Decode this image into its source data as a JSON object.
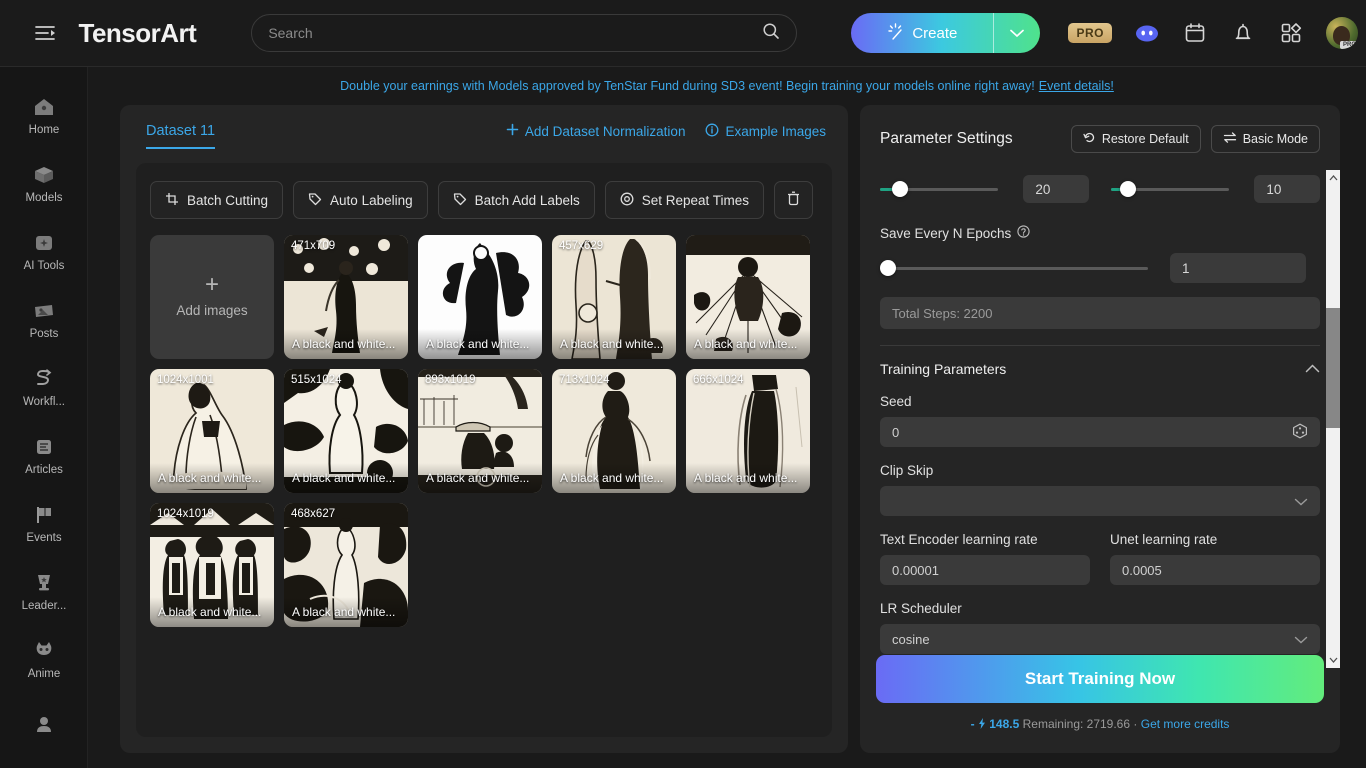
{
  "topbar": {
    "menu_icon": "menu-collapse-icon",
    "brand": "TensorArt",
    "search": {
      "value": "",
      "placeholder": "Search",
      "icon": "search-icon"
    },
    "create_label": "Create",
    "create_icon": "magic-wand-icon",
    "create_caret_icon": "chevron-down-icon",
    "pro_badge": "PRO",
    "icons": [
      "discord-icon",
      "calendar-icon",
      "bell-icon",
      "apps-grid-icon"
    ],
    "avatar_badge": "PRO"
  },
  "sidebar": {
    "items": [
      {
        "label": "Home",
        "icon": "home-icon"
      },
      {
        "label": "Models",
        "icon": "cube-icon"
      },
      {
        "label": "AI Tools",
        "icon": "sparkle-box-icon"
      },
      {
        "label": "Posts",
        "icon": "posts-icon"
      },
      {
        "label": "Workfl...",
        "icon": "workflow-icon"
      },
      {
        "label": "Articles",
        "icon": "article-icon"
      },
      {
        "label": "Events",
        "icon": "flag-icon"
      },
      {
        "label": "Leader...",
        "icon": "trophy-icon"
      },
      {
        "label": "Anime",
        "icon": "anime-cat-icon"
      },
      {
        "label": "",
        "icon": "person-icon"
      }
    ]
  },
  "banner": {
    "text": "Double your earnings with Models approved by TenStar Fund during SD3 event! Begin training your models online right away!",
    "link": "Event details!"
  },
  "dataset": {
    "tab_label": "Dataset 11",
    "actions": [
      {
        "label": "Add Dataset Normalization",
        "icon": "plus-icon"
      },
      {
        "label": "Example Images",
        "icon": "info-icon"
      }
    ],
    "tools": [
      {
        "label": "Batch Cutting",
        "icon": "crop-icon"
      },
      {
        "label": "Auto Labeling",
        "icon": "tag-icon"
      },
      {
        "label": "Batch Add Labels",
        "icon": "tag-icon"
      },
      {
        "label": "Set Repeat Times",
        "icon": "target-icon"
      }
    ],
    "delete_icon": "trash-icon",
    "add_images": {
      "label": "Add images",
      "icon": "plus-icon"
    },
    "images": [
      {
        "dim": "471x709",
        "caption": "A black and white...",
        "art": "lady-garden"
      },
      {
        "dim": "",
        "caption": "A black and white...",
        "art": "fan-lady"
      },
      {
        "dim": "457x629",
        "caption": "A black and white...",
        "art": "two-figures"
      },
      {
        "dim": "",
        "caption": "A black and white...",
        "art": "sunburst"
      },
      {
        "dim": "1024x1001",
        "caption": "A black and white...",
        "art": "kneeling-lady"
      },
      {
        "dim": "515x1024",
        "caption": "A black and white...",
        "art": "bull-scene"
      },
      {
        "dim": "893x1019",
        "caption": "A black and white...",
        "art": "boat-scene"
      },
      {
        "dim": "713x1024",
        "caption": "A black and white...",
        "art": "gown-lady"
      },
      {
        "dim": "666x1024",
        "caption": "A black and white...",
        "art": "tall-lady"
      },
      {
        "dim": "1024x1019",
        "caption": "A black and white...",
        "art": "three-figures"
      },
      {
        "dim": "468x627",
        "caption": "A black and white...",
        "art": "waves-figure"
      }
    ]
  },
  "params": {
    "title": "Parameter Settings",
    "restore_default": "Restore Default",
    "restore_icon": "undo-icon",
    "basic_mode": "Basic Mode",
    "basic_mode_icon": "swap-icon",
    "slider_a": {
      "value": "20",
      "percent": 16
    },
    "slider_b": {
      "value": "10",
      "percent": 12
    },
    "save_every_n_epochs": {
      "label": "Save Every N Epochs",
      "help_icon": "help-circle-icon",
      "value": "1",
      "percent": 1
    },
    "total_steps": "Total Steps: 2200",
    "training_parameters": {
      "title": "Training Parameters",
      "collapse_icon": "chevron-up-icon",
      "seed": {
        "label": "Seed",
        "value": "0",
        "icon": "dice-icon"
      },
      "clip_skip": {
        "label": "Clip Skip",
        "value": "",
        "icon": "chevron-down-icon"
      },
      "text_encoder_lr": {
        "label": "Text Encoder learning rate",
        "value": "0.00001"
      },
      "unet_lr": {
        "label": "Unet learning rate",
        "value": "0.0005"
      },
      "lr_scheduler": {
        "label": "LR Scheduler",
        "value": "cosine",
        "icon": "chevron-down-icon"
      }
    },
    "start_button": "Start Training Now",
    "credits": {
      "cost_prefix": "-",
      "bolt_icon": "bolt-icon",
      "cost": "148.5",
      "remaining": "Remaining: 2719.66",
      "separator": "·",
      "link": "Get more credits"
    },
    "scrollbar": {
      "up_icon": "chevron-up-icon",
      "down_icon": "chevron-down-icon"
    }
  },
  "colors": {
    "accent_blue": "#3ba7e8",
    "slider_green": "#1fa383",
    "panel_bg": "#252525"
  }
}
